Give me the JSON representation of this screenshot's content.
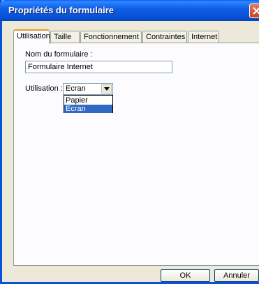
{
  "window": {
    "title": "Propriétés du formulaire"
  },
  "tabs": [
    {
      "label": "Utilisation",
      "active": true
    },
    {
      "label": "Taille",
      "active": false
    },
    {
      "label": "Fonctionnement",
      "active": false
    },
    {
      "label": "Contraintes",
      "active": false
    },
    {
      "label": "Internet",
      "active": false
    }
  ],
  "form": {
    "name_label": "Nom du formulaire :",
    "name_value": "Formulaire Internet",
    "usage_label": "Utilisation :",
    "usage_value": "Ecran",
    "usage_options": [
      {
        "label": "Papier",
        "selected": false
      },
      {
        "label": "Ecran",
        "selected": true
      }
    ]
  },
  "buttons": {
    "ok": "OK",
    "cancel": "Annuler"
  },
  "colors": {
    "titlebar": "#0a53d8",
    "selection": "#316ac5",
    "tab_highlight": "#e69a2c"
  }
}
